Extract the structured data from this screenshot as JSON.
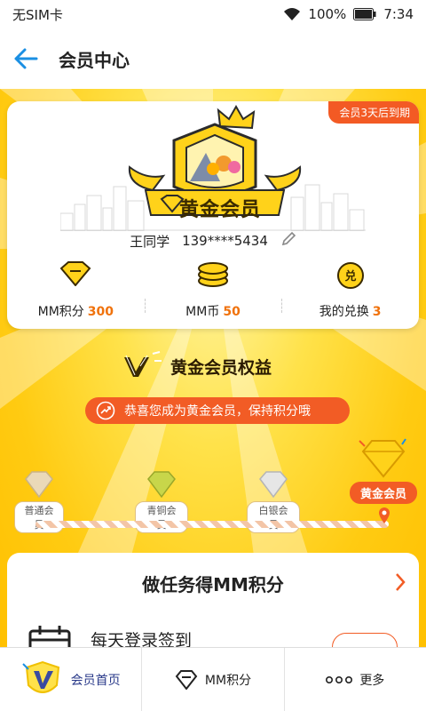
{
  "status_bar": {
    "carrier": "无SIM卡",
    "battery": "100%",
    "time": "7:34"
  },
  "header": {
    "title": "会员中心"
  },
  "member_card": {
    "expiry_badge": "会员3天后到期",
    "level_title": "黄金会员",
    "user_name": "王同学",
    "phone": "139****5434",
    "stats": [
      {
        "label": "MM积分",
        "value": "300"
      },
      {
        "label": "MM币",
        "value": "50"
      },
      {
        "label": "我的兑换",
        "value": "3"
      }
    ]
  },
  "rights": {
    "title": "黄金会员权益",
    "congrats": "恭喜您成为黄金会员，保持积分哦"
  },
  "levels": [
    {
      "label": "普通会员"
    },
    {
      "label": "青铜会员"
    },
    {
      "label": "白银会员"
    },
    {
      "label": "黄金会员"
    }
  ],
  "tasks": {
    "title": "做任务得MM积分",
    "first_task": "每天登录签到"
  },
  "bottom_nav": [
    {
      "label": "会员首页"
    },
    {
      "label": "MM积分"
    },
    {
      "label": "更多"
    }
  ],
  "colors": {
    "brand_orange": "#f25c25",
    "gold": "#ffd21a",
    "value_orange": "#f0720c"
  }
}
